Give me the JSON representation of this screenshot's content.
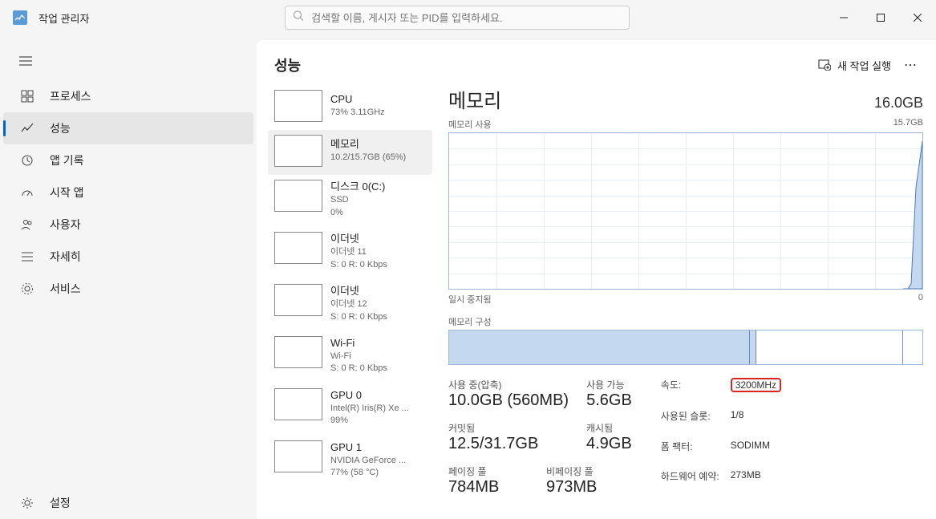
{
  "app": {
    "title": "작업 관리자"
  },
  "search": {
    "placeholder": "검색할 이름, 게시자 또는 PID를 입력하세요."
  },
  "sidebar": {
    "items": [
      {
        "label": "프로세스"
      },
      {
        "label": "성능"
      },
      {
        "label": "앱 기록"
      },
      {
        "label": "시작 앱"
      },
      {
        "label": "사용자"
      },
      {
        "label": "자세히"
      },
      {
        "label": "서비스"
      }
    ],
    "settings": "설정"
  },
  "header": {
    "page_title": "성능",
    "new_task": "새 작업 실행"
  },
  "resources": [
    {
      "name": "CPU",
      "sub1": "73% 3.11GHz",
      "sub2": ""
    },
    {
      "name": "메모리",
      "sub1": "10.2/15.7GB (65%)",
      "sub2": ""
    },
    {
      "name": "디스크 0(C:)",
      "sub1": "SSD",
      "sub2": "0%"
    },
    {
      "name": "이더넷",
      "sub1": "이더넷 11",
      "sub2": "S: 0 R: 0 Kbps"
    },
    {
      "name": "이더넷",
      "sub1": "이더넷 12",
      "sub2": "S: 0 R: 0 Kbps"
    },
    {
      "name": "Wi-Fi",
      "sub1": "Wi-Fi",
      "sub2": "S: 0 R: 0 Kbps"
    },
    {
      "name": "GPU 0",
      "sub1": "Intel(R) Iris(R) Xe ...",
      "sub2": "99%"
    },
    {
      "name": "GPU 1",
      "sub1": "NVIDIA GeForce ...",
      "sub2": "77% (58 °C)"
    }
  ],
  "detail": {
    "title": "메모리",
    "total": "16.0GB",
    "usage_chart": {
      "label": "메모리 사용",
      "max": "15.7GB",
      "footer_left": "일시 중지됨",
      "footer_right": "0"
    },
    "composition": {
      "label": "메모리 구성"
    },
    "stats": {
      "in_use": {
        "label": "사용 중(압축)",
        "value": "10.0GB (560MB)"
      },
      "available": {
        "label": "사용 가능",
        "value": "5.6GB"
      },
      "committed": {
        "label": "커밋됨",
        "value": "12.5/31.7GB"
      },
      "cached": {
        "label": "캐시됨",
        "value": "4.9GB"
      },
      "paged": {
        "label": "페이징 풀",
        "value": "784MB"
      },
      "nonpaged": {
        "label": "비페이징 풀",
        "value": "973MB"
      }
    },
    "kv": {
      "speed_label": "속도:",
      "speed_value": "3200MHz",
      "slots_label": "사용된 슬롯:",
      "slots_value": "1/8",
      "form_label": "폼 팩터:",
      "form_value": "SODIMM",
      "reserved_label": "하드웨어 예약:",
      "reserved_value": "273MB"
    }
  },
  "chart_data": {
    "type": "line",
    "title": "메모리 사용",
    "ylabel": "GB",
    "ylim": [
      0,
      15.7
    ],
    "x_seconds": 60,
    "note": "paused; only recent spike visible at right edge",
    "series": [
      {
        "name": "메모리 사용",
        "values_recent": [
          0,
          0,
          0.5,
          9,
          14
        ]
      }
    ],
    "composition_bar": {
      "type": "stacked-bar",
      "total_gb": 16.0,
      "segments": [
        {
          "name": "in_use",
          "gb": 10.0,
          "color": "#c4d8ef"
        },
        {
          "name": "modified",
          "gb": 0.2,
          "color": "#c4d8ef"
        },
        {
          "name": "standby",
          "gb": 4.9,
          "color": "#ffffff"
        },
        {
          "name": "free",
          "gb": 0.6,
          "color": "#ffffff"
        }
      ]
    }
  }
}
